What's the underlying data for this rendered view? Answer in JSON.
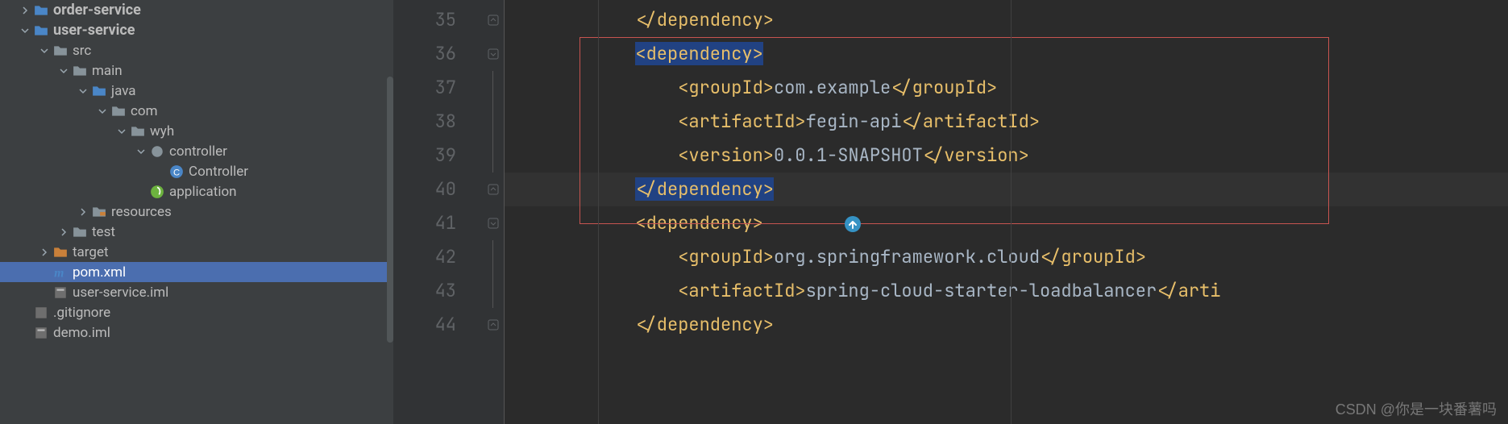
{
  "sidebar": {
    "rows": [
      {
        "indent": 18,
        "arrow": "right",
        "icon": "folder-blue",
        "label": "order-service",
        "bold": true
      },
      {
        "indent": 18,
        "arrow": "down",
        "icon": "folder-blue",
        "label": "user-service",
        "bold": true
      },
      {
        "indent": 42,
        "arrow": "down",
        "icon": "folder-grey",
        "label": "src",
        "bold": false
      },
      {
        "indent": 66,
        "arrow": "down",
        "icon": "folder-grey",
        "label": "main",
        "bold": false
      },
      {
        "indent": 90,
        "arrow": "down",
        "icon": "folder-blue",
        "label": "java",
        "bold": false
      },
      {
        "indent": 114,
        "arrow": "down",
        "icon": "folder-grey",
        "label": "com",
        "bold": false
      },
      {
        "indent": 138,
        "arrow": "down",
        "icon": "folder-grey",
        "label": "wyh",
        "bold": false
      },
      {
        "indent": 162,
        "arrow": "down",
        "icon": "package",
        "label": "controller",
        "bold": false
      },
      {
        "indent": 186,
        "arrow": "none",
        "icon": "class",
        "label": "Controller",
        "bold": false
      },
      {
        "indent": 162,
        "arrow": "none",
        "icon": "spring",
        "label": "application",
        "bold": false
      },
      {
        "indent": 90,
        "arrow": "right",
        "icon": "folder-res",
        "label": "resources",
        "bold": false
      },
      {
        "indent": 66,
        "arrow": "right",
        "icon": "folder-grey",
        "label": "test",
        "bold": false
      },
      {
        "indent": 42,
        "arrow": "right",
        "icon": "folder-orange",
        "label": "target",
        "bold": false
      },
      {
        "indent": 42,
        "arrow": "none",
        "icon": "maven",
        "label": "pom.xml",
        "bold": false,
        "selected": true
      },
      {
        "indent": 42,
        "arrow": "none",
        "icon": "iml",
        "label": "user-service.iml",
        "bold": false
      },
      {
        "indent": 18,
        "arrow": "none",
        "icon": "git",
        "label": ".gitignore",
        "bold": false
      },
      {
        "indent": 18,
        "arrow": "none",
        "icon": "iml",
        "label": "demo.iml",
        "bold": false
      }
    ]
  },
  "editor": {
    "lines": [
      {
        "n": 35,
        "indent": "            ",
        "fold": "up",
        "parts": [
          {
            "t": "tag",
            "v": "</dependency>"
          }
        ]
      },
      {
        "n": 36,
        "indent": "            ",
        "fold": "down",
        "parts": [
          {
            "t": "sel",
            "v": "<dependency>"
          }
        ]
      },
      {
        "n": 37,
        "indent": "                ",
        "fold": "line",
        "parts": [
          {
            "t": "tag",
            "v": "<groupId>"
          },
          {
            "t": "text",
            "v": "com.example"
          },
          {
            "t": "tag",
            "v": "</groupId>"
          }
        ]
      },
      {
        "n": 38,
        "indent": "                ",
        "fold": "line",
        "parts": [
          {
            "t": "tag",
            "v": "<artifactId>"
          },
          {
            "t": "text",
            "v": "fegin-api"
          },
          {
            "t": "tag",
            "v": "</artifactId>"
          }
        ]
      },
      {
        "n": 39,
        "indent": "                ",
        "fold": "line",
        "parts": [
          {
            "t": "tag",
            "v": "<version>"
          },
          {
            "t": "text",
            "v": "0.0.1-SNAPSHOT"
          },
          {
            "t": "tag",
            "v": "</version>"
          }
        ]
      },
      {
        "n": 40,
        "indent": "            ",
        "hl": true,
        "fold": "up",
        "parts": [
          {
            "t": "sel",
            "v": "</dependency>"
          }
        ]
      },
      {
        "n": 41,
        "indent": "            ",
        "fold": "down",
        "parts": [
          {
            "t": "tag",
            "v": "<dependency>"
          }
        ]
      },
      {
        "n": 42,
        "indent": "                ",
        "fold": "line",
        "parts": [
          {
            "t": "tag",
            "v": "<groupId>"
          },
          {
            "t": "text",
            "v": "org.springframework.cloud"
          },
          {
            "t": "tag",
            "v": "</groupId>"
          }
        ]
      },
      {
        "n": 43,
        "indent": "                ",
        "fold": "line",
        "parts": [
          {
            "t": "tag",
            "v": "<artifactId>"
          },
          {
            "t": "text",
            "v": "spring-cloud-starter-loadbalancer"
          },
          {
            "t": "tag",
            "v": "</arti"
          }
        ]
      },
      {
        "n": 44,
        "indent": "            ",
        "fold": "up",
        "parts": [
          {
            "t": "tag",
            "v": "</dependency>"
          }
        ]
      }
    ],
    "verticals": [
      116,
      628
    ]
  },
  "watermark": "CSDN @你是一块番薯吗"
}
